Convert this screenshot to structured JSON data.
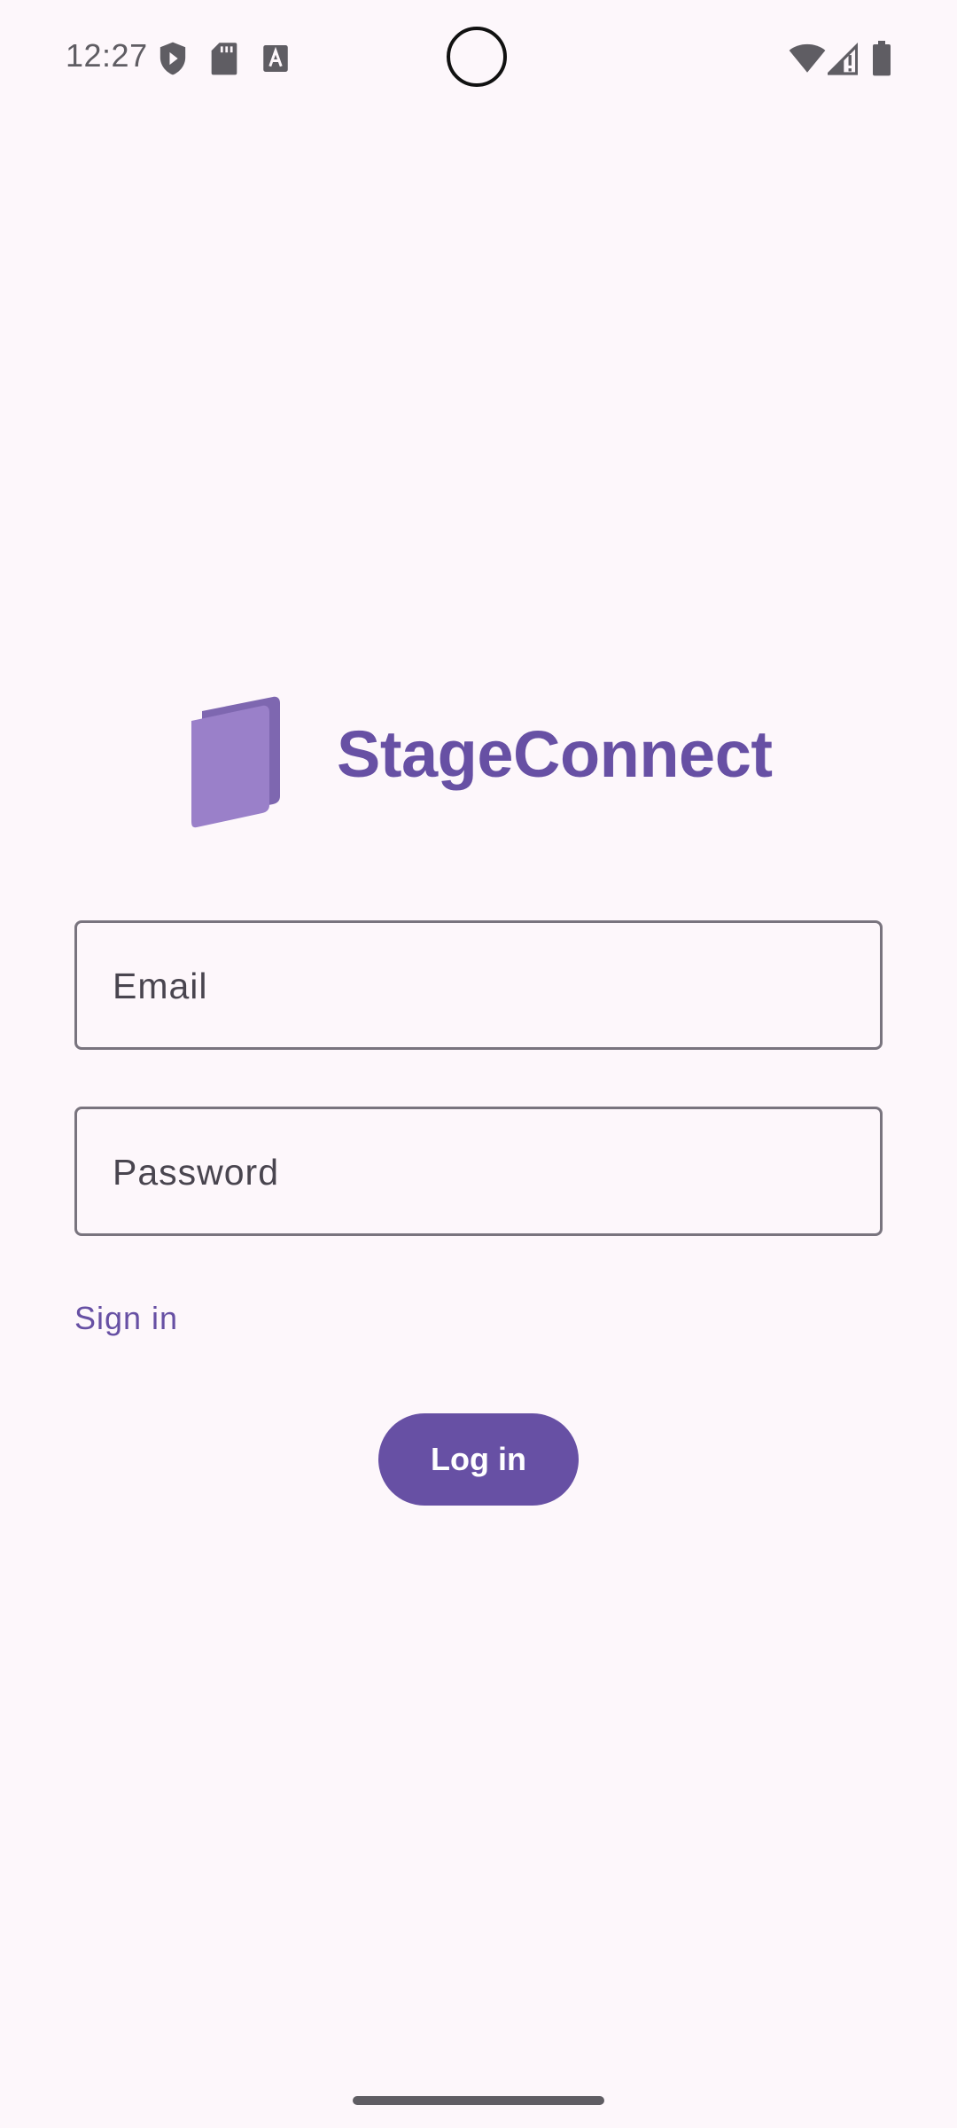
{
  "status_bar": {
    "time": "12:27",
    "left_icons": [
      "shield-play-icon",
      "sd-card-icon",
      "text-a-icon"
    ],
    "right_icons": [
      "wifi-icon",
      "cell-signal-icon",
      "battery-icon"
    ]
  },
  "brand": {
    "app_name": "StageConnect",
    "logo_icon": "stacked-cards-logo-icon"
  },
  "form": {
    "email_label": "Email",
    "password_label": "Password"
  },
  "links": {
    "sign_in": "Sign in"
  },
  "actions": {
    "login_label": "Log in"
  },
  "colors": {
    "accent": "#6750a4",
    "background": "#fdf7fb",
    "outline": "#79747e"
  }
}
